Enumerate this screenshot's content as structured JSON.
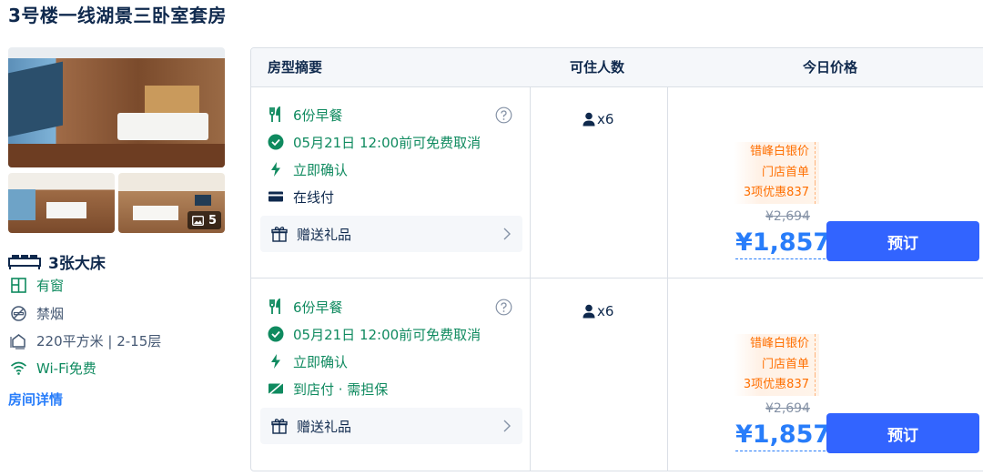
{
  "title": "3号楼一线湖景三卧室套房",
  "photos": {
    "count": "5",
    "count_icon": "image-icon"
  },
  "features": {
    "bed": "3张大床",
    "window": "有窗",
    "smoking": "禁烟",
    "area": "220平方米 | 2-15层",
    "wifi": "Wi-Fi免费",
    "detail_link": "房间详情"
  },
  "table": {
    "headers": {
      "summary": "房型摘要",
      "occupancy": "可住人数",
      "price": "今日价格"
    },
    "rows": [
      {
        "breakfast": "6份早餐",
        "cancel": "05月21日 12:00前可免费取消",
        "confirm": "立即确认",
        "payment": "在线付",
        "gift": "赠送礼品",
        "occupancy": "x6",
        "promo": [
          "错峰白银价",
          "门店首单",
          "3项优惠837"
        ],
        "original_price": "¥2,694",
        "price": "¥1,857",
        "book": "预订"
      },
      {
        "breakfast": "6份早餐",
        "cancel": "05月21日 12:00前可免费取消",
        "confirm": "立即确认",
        "payment": "到店付 · 需担保",
        "gift": "赠送礼品",
        "occupancy": "x6",
        "promo": [
          "错峰白银价",
          "门店首单",
          "3项优惠837"
        ],
        "original_price": "¥2,694",
        "price": "¥1,857",
        "book": "预订"
      }
    ]
  },
  "colors": {
    "green": "#0f8a5f",
    "blue": "#287dfa",
    "button": "#3264ff",
    "promo": "#ff6f00"
  }
}
